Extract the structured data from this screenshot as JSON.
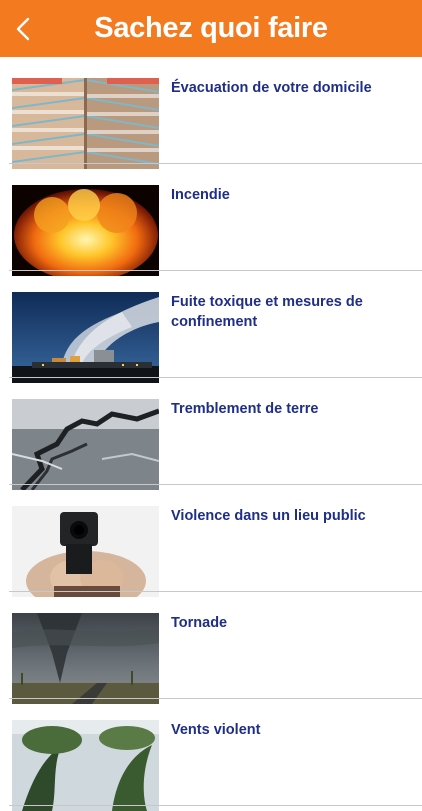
{
  "header": {
    "title": "Sachez quoi faire"
  },
  "items": [
    {
      "label": "Évacuation de votre domicile",
      "image": "stairwell-building"
    },
    {
      "label": "Incendie",
      "image": "fire-explosion"
    },
    {
      "label": "Fuite toxique et mesures de confinement",
      "image": "power-plant-smoke"
    },
    {
      "label": "Tremblement de terre",
      "image": "cracked-road"
    },
    {
      "label": "Violence dans un lieu public",
      "image": "person-with-gun"
    },
    {
      "label": "Tornade",
      "image": "tornado-storm"
    },
    {
      "label": "Vents violent",
      "image": "wind-trees"
    }
  ],
  "colors": {
    "header_bg": "#F47A20",
    "title_text": "#FFFFFF",
    "item_text": "#1F2E86",
    "separator": "#C8C8CC"
  }
}
